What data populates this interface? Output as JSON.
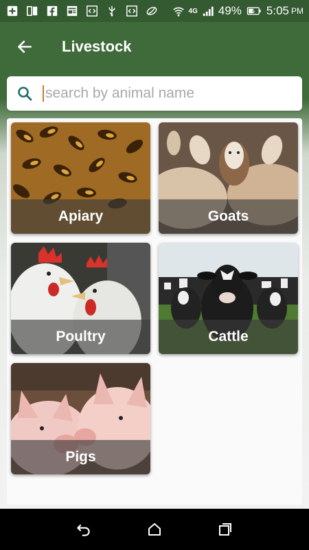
{
  "status_bar": {
    "battery": "49%",
    "time": "5:05",
    "time_suffix": "PM",
    "network": "4G",
    "icons": [
      "add-square-icon",
      "dual-sim-icon",
      "facebook-icon",
      "news-icon",
      "code-icon",
      "usb-icon",
      "code-icon",
      "swirl-icon",
      "wifi-icon",
      "signal-icon",
      "battery-charging-icon"
    ]
  },
  "app_bar": {
    "title": "Livestock",
    "back_icon": "arrow-back-icon"
  },
  "search": {
    "placeholder": "search by animal name",
    "value": "",
    "icon": "search-icon"
  },
  "animals": [
    {
      "label": "Apiary"
    },
    {
      "label": "Goats"
    },
    {
      "label": "Poultry"
    },
    {
      "label": "Cattle"
    },
    {
      "label": "Pigs"
    }
  ],
  "nav_bar": {
    "icons": [
      "back-icon",
      "home-icon",
      "recents-icon"
    ]
  },
  "colors": {
    "primary": "#3f6b3a",
    "primary_dark": "#335a30",
    "accent": "#1f6f6a"
  }
}
